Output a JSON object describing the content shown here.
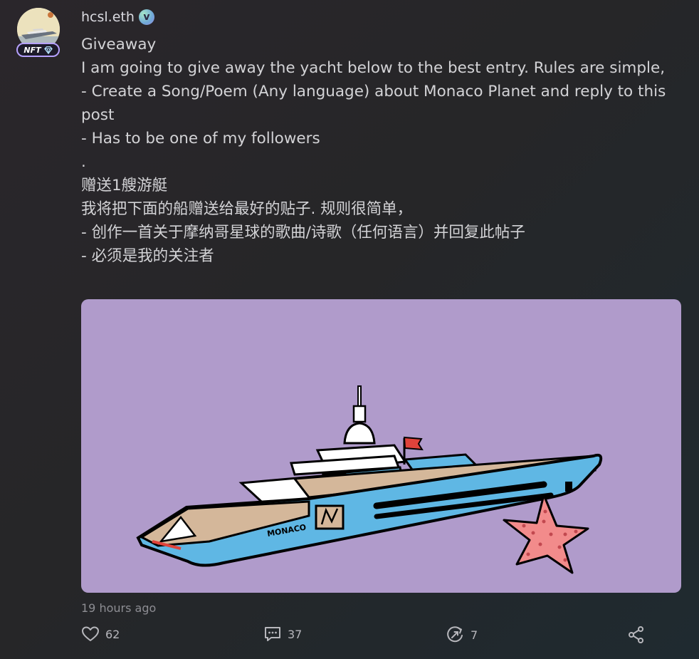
{
  "post": {
    "username": "hcsl.eth",
    "verified_glyph": "v",
    "nft_badge": "NFT",
    "lines": [
      "Giveaway",
      "I am going to give away the yacht below to the best entry. Rules are simple,",
      "- Create a Song/Poem (Any language) about Monaco Planet and reply to this post",
      "- Has to be one of my followers",
      ".",
      "赠送1艘游艇",
      "我将把下面的船赠送给最好的贴子. 规则很简单，",
      "- 创作一首关于摩纳哥星球的歌曲/诗歌（任何语言）并回复此帖子",
      "- 必须是我的关注者"
    ],
    "image": {
      "background": "#b09bcb",
      "hull_text": "MONACO",
      "icon": "yacht-starfish-illustration"
    },
    "timestamp": "19 hours ago",
    "actions": {
      "likes": "62",
      "comments": "37",
      "reposts": "7"
    }
  },
  "colors": {
    "accent_badge_border": "#b6a1ff",
    "text_primary": "#d3d3d6",
    "text_muted": "#8d8d93",
    "image_bg": "#b09bcb",
    "hull_blue": "#5fb7e4",
    "starfish": "#f28b8b"
  },
  "icons": {
    "like": "heart-icon",
    "comment": "comment-icon",
    "repost": "repost-icon",
    "share": "share-icon",
    "diamond": "diamond-icon"
  }
}
